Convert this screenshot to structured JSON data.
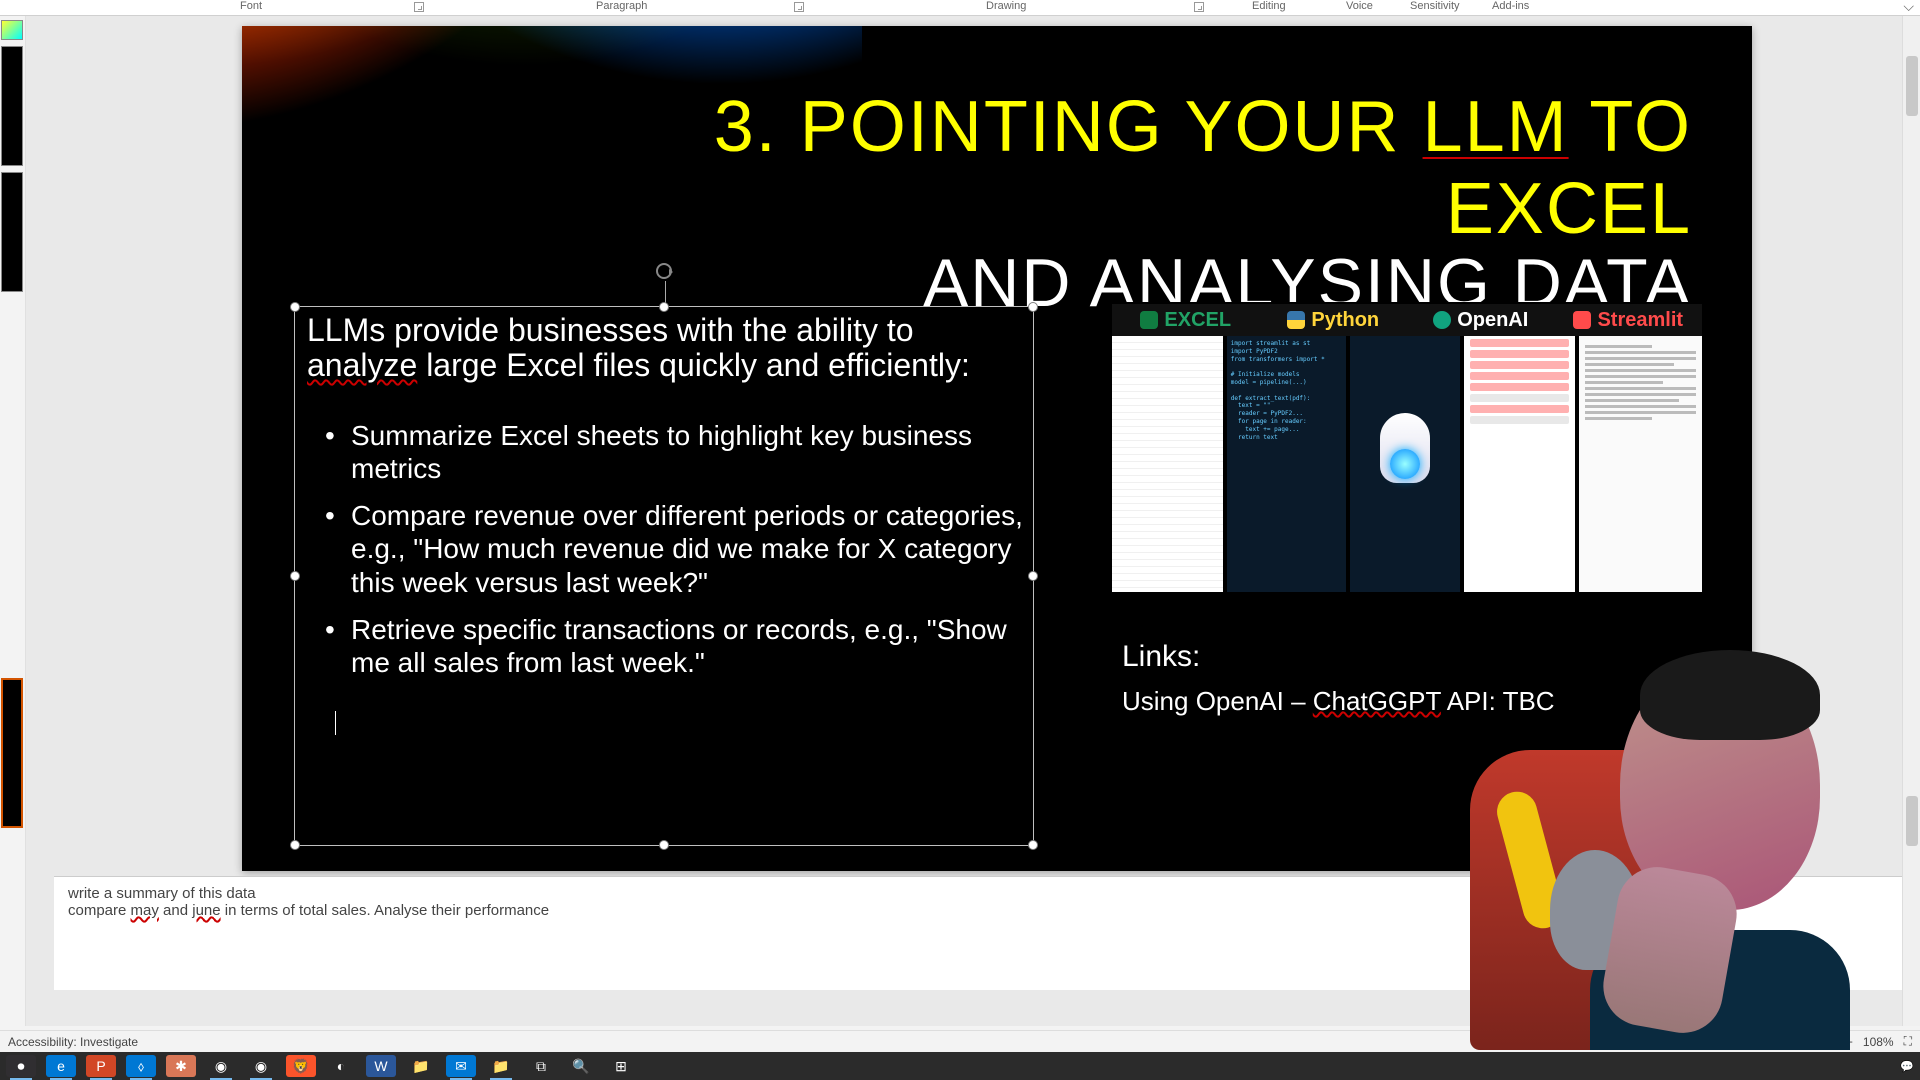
{
  "ribbon": {
    "groups": [
      "Font",
      "Paragraph",
      "Drawing",
      "Editing",
      "Voice",
      "Sensitivity",
      "Add-ins"
    ]
  },
  "slide": {
    "title_line1_pre": "3. POINTING YOUR ",
    "title_line1_ul": "LLM",
    "title_line1_post": " TO EXCEL",
    "title_line2": "AND ANALYSING DATA",
    "lead_pre": "LLMs provide businesses with the ability to ",
    "lead_sq": "analyze",
    "lead_post": " large Excel files quickly and efficiently:",
    "bullets": [
      "Summarize Excel sheets to highlight key business metrics",
      "Compare revenue over different periods or categories, e.g., \"How much revenue did we make for X category this week versus last week?\"",
      "Retrieve specific transactions or records, e.g., \"Show me all sales from last week.\""
    ],
    "tech_cards": [
      {
        "label": "EXCEL",
        "color": "#21a366",
        "icon_bg": "#107c41"
      },
      {
        "label": "Python",
        "color": "#ffd43b",
        "icon_bg": "#3776ab"
      },
      {
        "label": "OpenAI",
        "color": "#10a37f",
        "icon_bg": "#10a37f"
      },
      {
        "label": "Streamlit",
        "color": "#ff4b4b",
        "icon_bg": "#ff4b4b"
      }
    ],
    "links_heading": "Links:",
    "links_row_pre": "Using OpenAI – ",
    "links_row_sq": "ChatGGPT",
    "links_row_post": " API: TBC"
  },
  "notes": {
    "line1": "write a summary of this data",
    "line2_pre": "compare ",
    "line2_sq1": "may",
    "line2_mid": " and ",
    "line2_sq2": "june",
    "line2_post": " in terms of total sales. Analyse their performance"
  },
  "status": {
    "accessibility": "Accessibility: Investigate",
    "zoom": "108%"
  },
  "taskbar": {
    "icons": [
      {
        "name": "start",
        "glyph": "⊞",
        "bg": "",
        "active": false
      },
      {
        "name": "search",
        "glyph": "🔍",
        "bg": "",
        "active": false
      },
      {
        "name": "taskview",
        "glyph": "⧉",
        "bg": "",
        "active": false
      },
      {
        "name": "explorer",
        "glyph": "📁",
        "bg": "",
        "active": true
      },
      {
        "name": "mail",
        "glyph": "✉",
        "bg": "#0078d4",
        "active": true
      },
      {
        "name": "folder",
        "glyph": "📁",
        "bg": "",
        "active": false
      },
      {
        "name": "word",
        "glyph": "W",
        "bg": "#2b579a",
        "active": false
      },
      {
        "name": "copilot",
        "glyph": "◐",
        "bg": "",
        "active": false
      },
      {
        "name": "brave",
        "glyph": "🦁",
        "bg": "#fb542b",
        "active": false
      },
      {
        "name": "chrome",
        "glyph": "◉",
        "bg": "",
        "active": true
      },
      {
        "name": "chrome2",
        "glyph": "◉",
        "bg": "",
        "active": true
      },
      {
        "name": "claude",
        "glyph": "✱",
        "bg": "#d97757",
        "active": false
      },
      {
        "name": "vscode",
        "glyph": "⬨",
        "bg": "#0078d4",
        "active": true
      },
      {
        "name": "powerpoint",
        "glyph": "P",
        "bg": "#d24726",
        "active": true
      },
      {
        "name": "edge",
        "glyph": "e",
        "bg": "#0078d4",
        "active": true
      },
      {
        "name": "obs",
        "glyph": "⏺",
        "bg": "#302e31",
        "active": true
      }
    ]
  }
}
